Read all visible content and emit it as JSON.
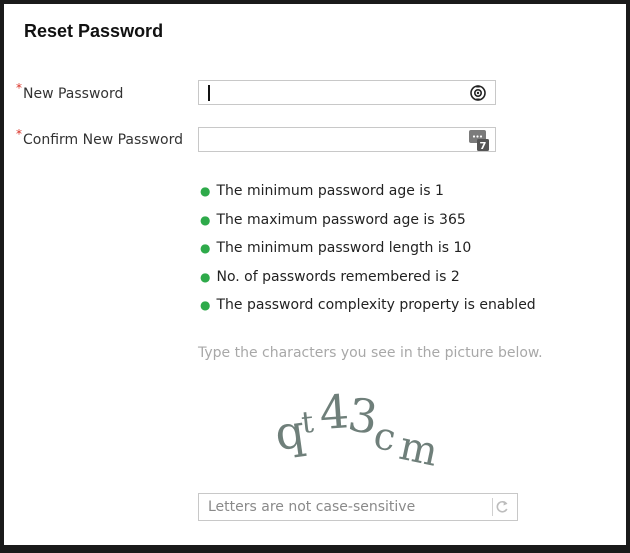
{
  "dialog": {
    "title": "Reset Password"
  },
  "fields": {
    "new_password": {
      "label": "New Password",
      "required_mark": "*",
      "value": ""
    },
    "confirm_password": {
      "label": "Confirm New Password",
      "required_mark": "*",
      "value": ""
    }
  },
  "keypad_badge": "7",
  "policy_rules": [
    "The minimum password age is 1",
    "The maximum password age is 365",
    "The minimum password length is 10",
    "No. of passwords remembered is 2",
    "The password complexity property is enabled"
  ],
  "captcha": {
    "hint": "Type the characters you see in the picture below.",
    "image_text": "qt43cm",
    "placeholder": "Letters are not case-sensitive"
  },
  "colors": {
    "bullet": "#2eaa4a",
    "required": "#d93025",
    "captcha_text": "#6f7f7a"
  },
  "icons": {
    "reveal": "eye-reveal-icon",
    "keypad": "virtual-keypad-icon",
    "refresh": "refresh-icon"
  }
}
